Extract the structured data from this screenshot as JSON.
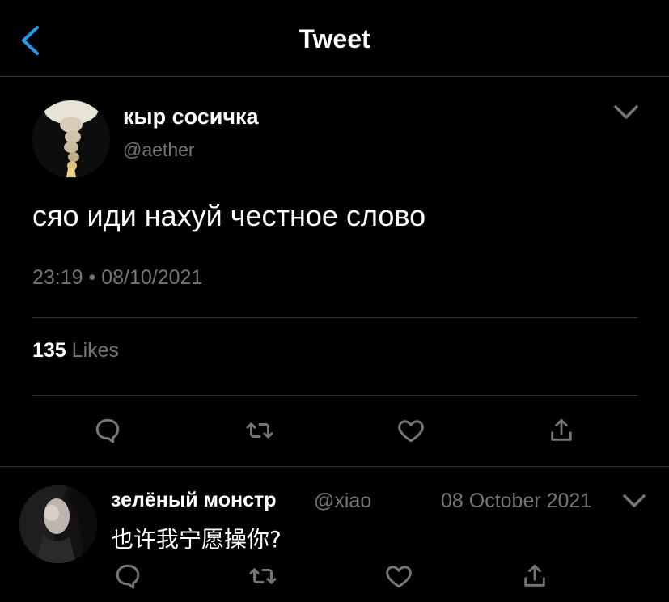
{
  "header": {
    "title": "Tweet",
    "back_icon": "chevron-left-icon",
    "accent_color": "#1d9bf0"
  },
  "tweet": {
    "author_name": "кыр сосичка",
    "author_handle": "@aether",
    "text": "сяо иди нахуй честное слово",
    "timestamp": "23:19 • 08/10/2021",
    "likes_count": "135",
    "likes_label": "Likes",
    "actions": [
      "reply-icon",
      "retweet-icon",
      "like-icon",
      "share-icon"
    ]
  },
  "reply": {
    "author_name": "зелёный монстр",
    "author_handle": "@xiao",
    "date": "08 October 2021",
    "text": "也许我宁愿操你?",
    "actions": [
      "reply-icon",
      "retweet-icon",
      "like-icon",
      "share-icon"
    ]
  },
  "colors": {
    "background": "#000000",
    "text_primary": "#ffffff",
    "text_secondary": "#71767b",
    "divider": "#2f3336"
  }
}
